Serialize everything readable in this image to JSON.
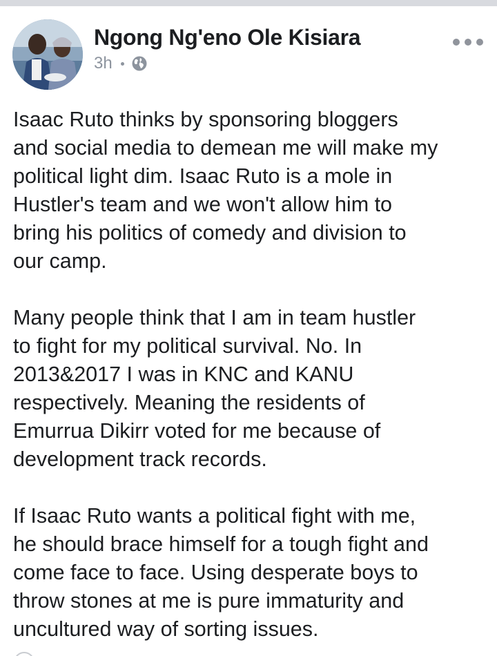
{
  "post": {
    "author": "Ngong Ng'eno Ole Kisiara",
    "time": "3h",
    "audience_icon": "globe-icon",
    "more_icon": "more-options-icon",
    "paragraphs": [
      "Isaac Ruto thinks by sponsoring bloggers\nand social media to demean me will make my\npolitical light dim. Isaac Ruto is a mole in\nHustler's team and we won't allow him to\nbring his politics of comedy and division to\nour camp.",
      "Many people think that I am in team hustler\nto fight for my political survival. No. In\n2013&2017  I was in KNC and KANU\nrespectively.  Meaning the residents of\nEmurrua Dikirr voted for me because of\ndevelopment track records.",
      "If Isaac Ruto wants a political fight with me,\nhe should brace himself for a tough fight and\ncome face to face. Using desperate boys to\nthrow stones at me is pure immaturity and\nuncultured way of sorting issues."
    ]
  },
  "colors": {
    "text": "#1c1e21",
    "meta": "#8d949e",
    "top_strip": "#d8dadf"
  }
}
